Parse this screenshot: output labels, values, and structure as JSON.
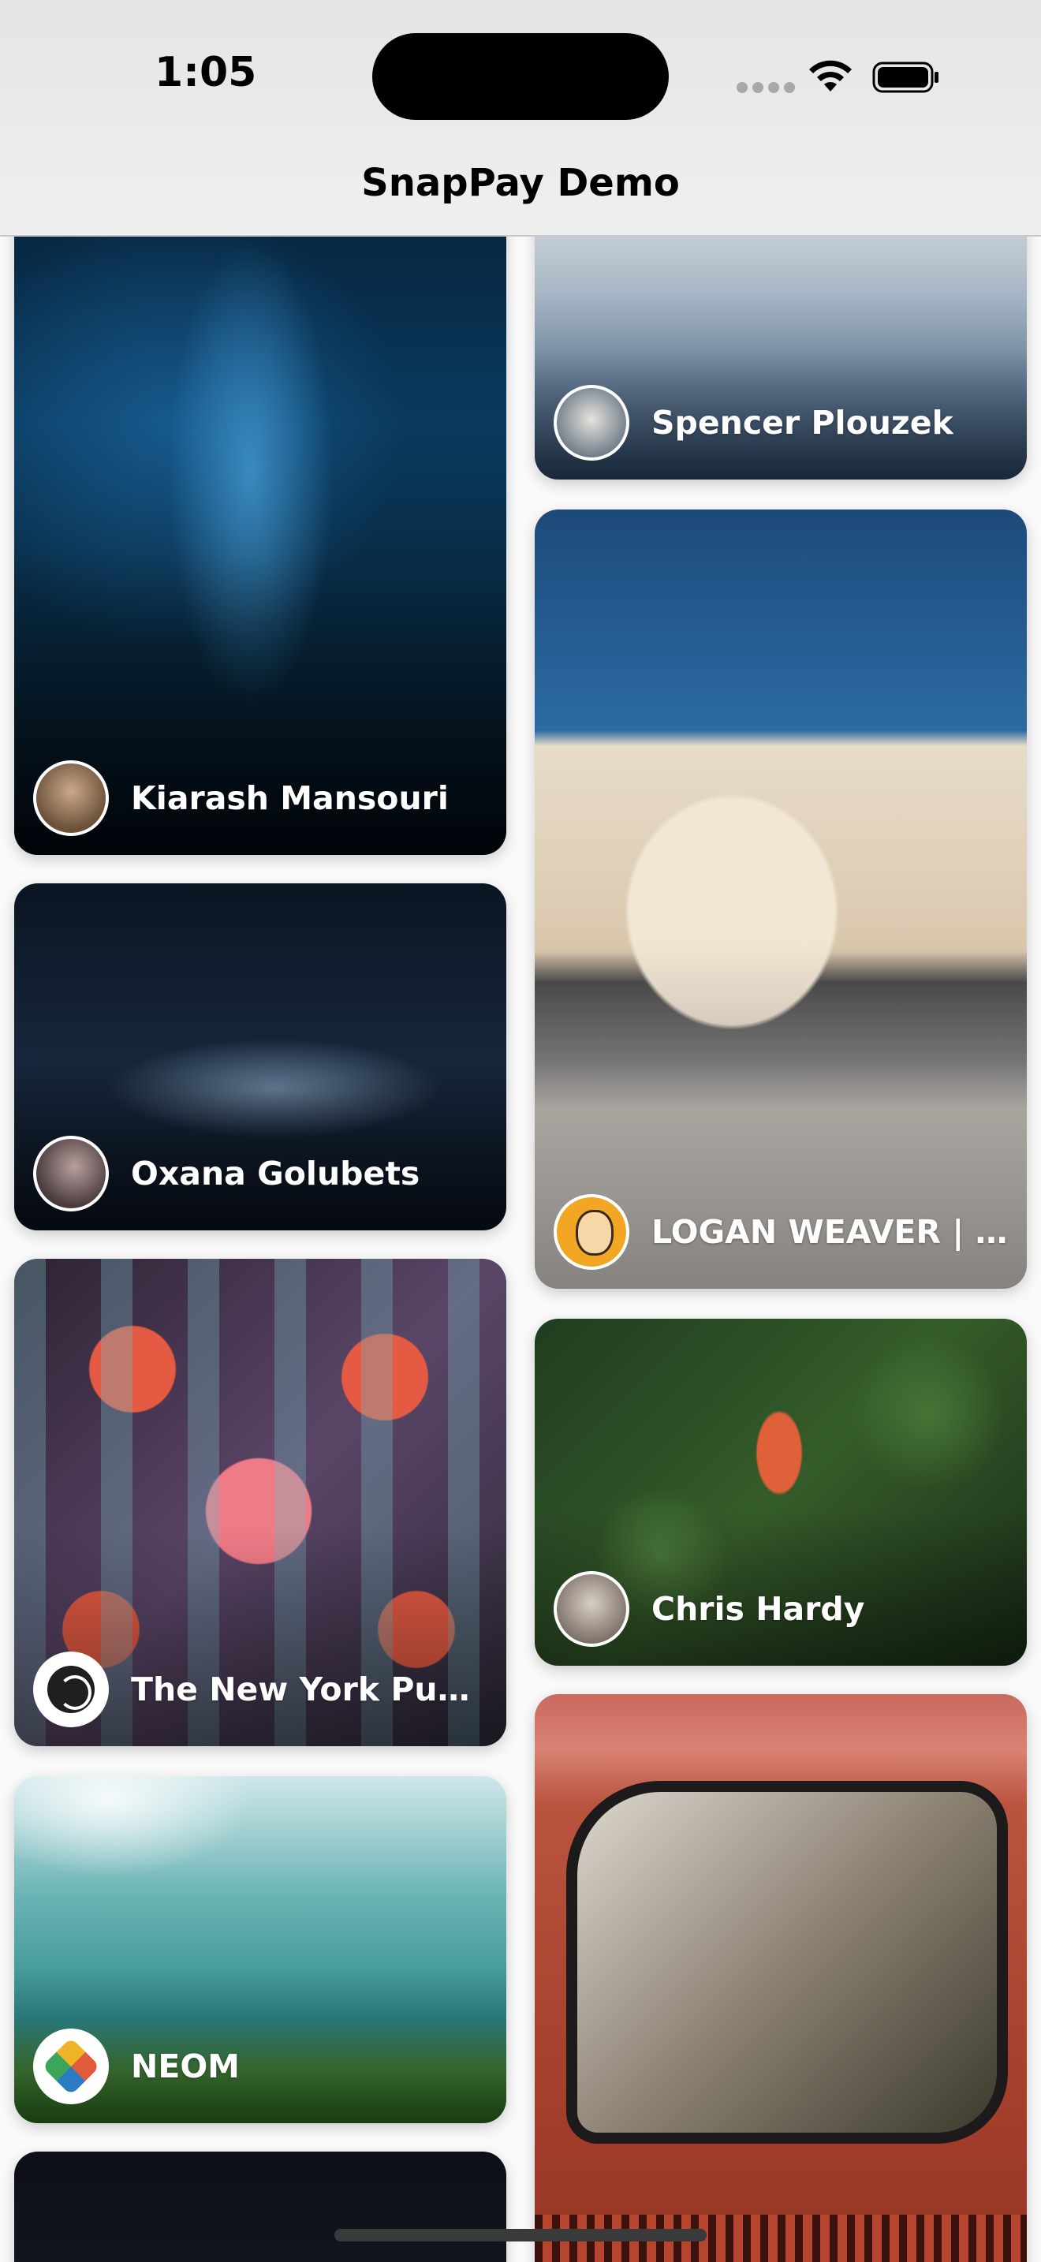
{
  "status_bar": {
    "time": "1:05",
    "icons": [
      "cellular-dots-icon",
      "wifi-icon",
      "battery-icon"
    ]
  },
  "nav": {
    "title": "SnapPay Demo"
  },
  "feed": {
    "left_column": [
      {
        "author": "Kiarash Mansouri",
        "photo": "foggy-tower-at-night"
      },
      {
        "author": "Oxana Golubets",
        "photo": "abstract-dark-waves"
      },
      {
        "author": "The New York Public...",
        "photo": "colorful-pattern-print"
      },
      {
        "author": "NEOM",
        "photo": "underwater-diver"
      },
      {
        "author": "",
        "photo": "dark-night-sky"
      }
    ],
    "right_column": [
      {
        "author": "Spencer Plouzek",
        "photo": "misty-sea"
      },
      {
        "author": "LOGAN WEAVER | @...",
        "photo": "dog-in-truck"
      },
      {
        "author": "Chris Hardy",
        "photo": "butterfly-on-flower"
      },
      {
        "author": "",
        "photo": "red-car-rear-window-flowers"
      }
    ]
  },
  "colors": {
    "navbar_bg": "#ececec",
    "author_text": "#ffffff",
    "dynamic_island": "#000000"
  }
}
